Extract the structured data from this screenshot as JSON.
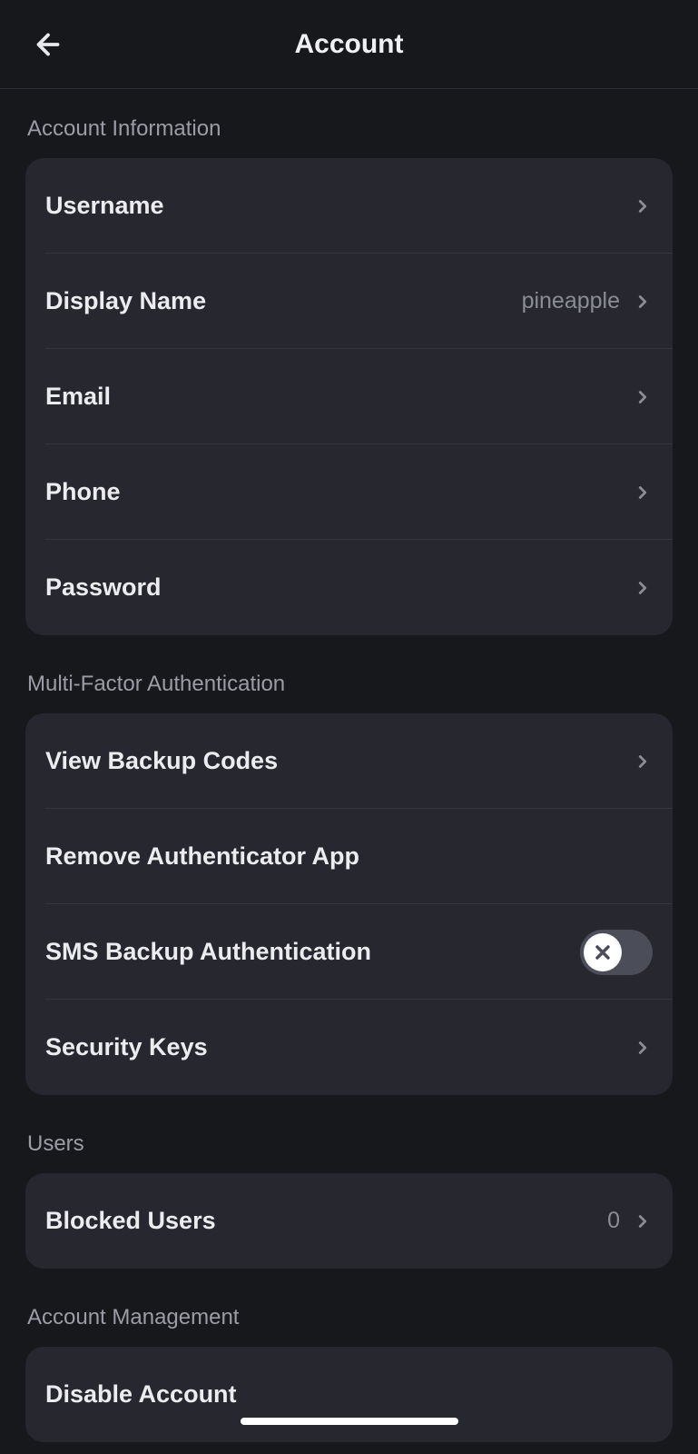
{
  "header": {
    "title": "Account"
  },
  "sections": {
    "accountInfo": {
      "header": "Account Information",
      "items": {
        "username": {
          "label": "Username"
        },
        "displayName": {
          "label": "Display Name",
          "value": "pineapple"
        },
        "email": {
          "label": "Email"
        },
        "phone": {
          "label": "Phone"
        },
        "password": {
          "label": "Password"
        }
      }
    },
    "mfa": {
      "header": "Multi-Factor Authentication",
      "items": {
        "viewBackupCodes": {
          "label": "View Backup Codes"
        },
        "removeAuthApp": {
          "label": "Remove Authenticator App"
        },
        "smsBackup": {
          "label": "SMS Backup Authentication",
          "toggle": false
        },
        "securityKeys": {
          "label": "Security Keys"
        }
      }
    },
    "users": {
      "header": "Users",
      "items": {
        "blockedUsers": {
          "label": "Blocked Users",
          "value": "0"
        }
      }
    },
    "accountManagement": {
      "header": "Account Management",
      "items": {
        "disableAccount": {
          "label": "Disable Account"
        }
      }
    }
  }
}
